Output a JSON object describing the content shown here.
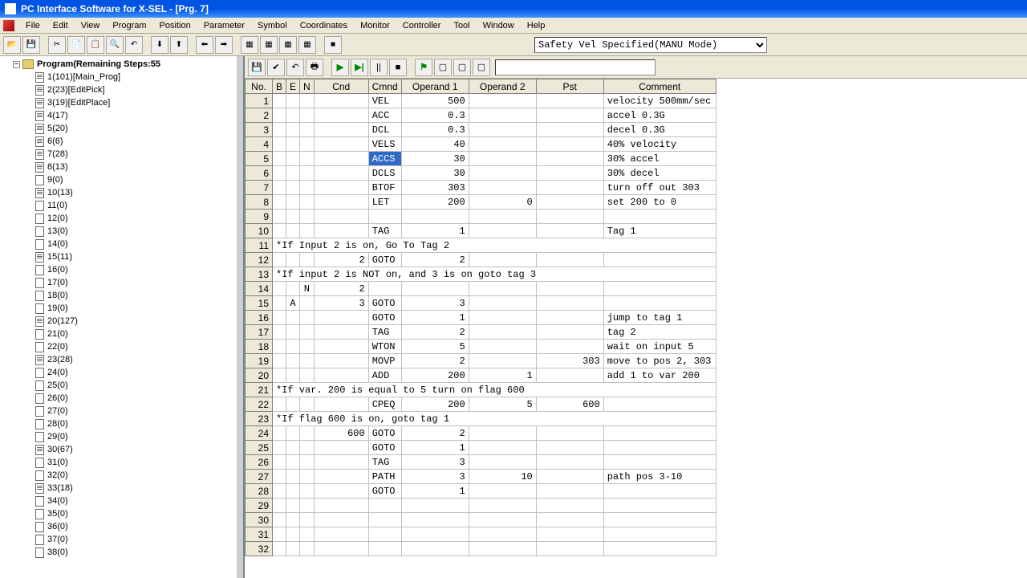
{
  "title": "PC Interface Software for X-SEL - [Prg. 7]",
  "menu": [
    "File",
    "Edit",
    "View",
    "Program",
    "Position",
    "Parameter",
    "Symbol",
    "Coordinates",
    "Monitor",
    "Controller",
    "Tool",
    "Window",
    "Help"
  ],
  "mode_options": [
    "Safety Vel Specified(MANU Mode)"
  ],
  "mode_selected": "Safety Vel Specified(MANU Mode)",
  "tree": {
    "root": "Program(Remaining Steps:55",
    "items": [
      {
        "label": "1(101)[Main_Prog]",
        "filled": true
      },
      {
        "label": "2(23)[EditPick]",
        "filled": true
      },
      {
        "label": "3(19)[EditPlace]",
        "filled": true
      },
      {
        "label": "4(17)",
        "filled": true
      },
      {
        "label": "5(20)",
        "filled": true
      },
      {
        "label": "6(6)",
        "filled": true
      },
      {
        "label": "7(28)",
        "filled": true
      },
      {
        "label": "8(13)",
        "filled": true
      },
      {
        "label": "9(0)",
        "filled": false
      },
      {
        "label": "10(13)",
        "filled": true
      },
      {
        "label": "11(0)",
        "filled": false
      },
      {
        "label": "12(0)",
        "filled": false
      },
      {
        "label": "13(0)",
        "filled": false
      },
      {
        "label": "14(0)",
        "filled": false
      },
      {
        "label": "15(11)",
        "filled": true
      },
      {
        "label": "16(0)",
        "filled": false
      },
      {
        "label": "17(0)",
        "filled": false
      },
      {
        "label": "18(0)",
        "filled": false
      },
      {
        "label": "19(0)",
        "filled": false
      },
      {
        "label": "20(127)",
        "filled": true
      },
      {
        "label": "21(0)",
        "filled": false
      },
      {
        "label": "22(0)",
        "filled": false
      },
      {
        "label": "23(28)",
        "filled": true
      },
      {
        "label": "24(0)",
        "filled": false
      },
      {
        "label": "25(0)",
        "filled": false
      },
      {
        "label": "26(0)",
        "filled": false
      },
      {
        "label": "27(0)",
        "filled": false
      },
      {
        "label": "28(0)",
        "filled": false
      },
      {
        "label": "29(0)",
        "filled": false
      },
      {
        "label": "30(67)",
        "filled": true
      },
      {
        "label": "31(0)",
        "filled": false
      },
      {
        "label": "32(0)",
        "filled": false
      },
      {
        "label": "33(18)",
        "filled": true
      },
      {
        "label": "34(0)",
        "filled": false
      },
      {
        "label": "35(0)",
        "filled": false
      },
      {
        "label": "36(0)",
        "filled": false
      },
      {
        "label": "37(0)",
        "filled": false
      },
      {
        "label": "38(0)",
        "filled": false
      }
    ]
  },
  "grid": {
    "headers": {
      "no": "No.",
      "b": "B",
      "e": "E",
      "n": "N",
      "cnd": "Cnd",
      "cmnd": "Cmnd",
      "op1": "Operand 1",
      "op2": "Operand 2",
      "pst": "Pst",
      "comment": "Comment"
    },
    "rows": [
      {
        "no": 1,
        "cmnd": "VEL",
        "op1": "500",
        "comment": "velocity 500mm/sec"
      },
      {
        "no": 2,
        "cmnd": "ACC",
        "op1": "0.3",
        "comment": "accel 0.3G"
      },
      {
        "no": 3,
        "cmnd": "DCL",
        "op1": "0.3",
        "comment": "decel 0.3G"
      },
      {
        "no": 4,
        "cmnd": "VELS",
        "op1": "40",
        "comment": "40% velocity"
      },
      {
        "no": 5,
        "cmnd": "ACCS",
        "op1": "30",
        "comment": "30% accel",
        "sel": "cmnd"
      },
      {
        "no": 6,
        "cmnd": "DCLS",
        "op1": "30",
        "comment": "30% decel"
      },
      {
        "no": 7,
        "cmnd": "BTOF",
        "op1": "303",
        "comment": "turn off out 303"
      },
      {
        "no": 8,
        "cmnd": "LET",
        "op1": "200",
        "op2": "0",
        "comment": "set 200 to 0"
      },
      {
        "no": 9
      },
      {
        "no": 10,
        "cmnd": "TAG",
        "op1": "1",
        "comment": "Tag 1"
      },
      {
        "no": 11,
        "fullcomment": "*If Input 2 is on, Go To Tag 2"
      },
      {
        "no": 12,
        "cnd": "2",
        "cmnd": "GOTO",
        "op1": "2"
      },
      {
        "no": 13,
        "fullcomment": "*If input 2 is NOT on, and 3 is on goto tag 3"
      },
      {
        "no": 14,
        "n": "N",
        "cnd": "2"
      },
      {
        "no": 15,
        "e": "A",
        "cnd": "3",
        "cmnd": "GOTO",
        "op1": "3"
      },
      {
        "no": 16,
        "cmnd": "GOTO",
        "op1": "1",
        "comment": "jump to tag 1"
      },
      {
        "no": 17,
        "cmnd": "TAG",
        "op1": "2",
        "comment": "tag 2"
      },
      {
        "no": 18,
        "cmnd": "WTON",
        "op1": "5",
        "comment": "wait on input 5"
      },
      {
        "no": 19,
        "cmnd": "MOVP",
        "op1": "2",
        "pst": "303",
        "comment": "move to pos 2, 303"
      },
      {
        "no": 20,
        "cmnd": "ADD",
        "op1": "200",
        "op2": "1",
        "comment": "add 1 to var 200"
      },
      {
        "no": 21,
        "fullcomment": "*If var. 200 is equal to 5 turn on flag 600"
      },
      {
        "no": 22,
        "cmnd": "CPEQ",
        "op1": "200",
        "op2": "5",
        "pst": "600"
      },
      {
        "no": 23,
        "fullcomment": "*If flag 600 is on, goto tag 1"
      },
      {
        "no": 24,
        "cnd": "600",
        "cmnd": "GOTO",
        "op1": "2"
      },
      {
        "no": 25,
        "cmnd": "GOTO",
        "op1": "1"
      },
      {
        "no": 26,
        "cmnd": "TAG",
        "op1": "3"
      },
      {
        "no": 27,
        "cmnd": "PATH",
        "op1": "3",
        "op2": "10",
        "comment": "path pos 3-10"
      },
      {
        "no": 28,
        "cmnd": "GOTO",
        "op1": "1"
      },
      {
        "no": 29
      },
      {
        "no": 30
      },
      {
        "no": 31
      },
      {
        "no": 32
      }
    ]
  },
  "main_toolbar_icons": [
    "open",
    "save",
    "|",
    "cut",
    "copy",
    "paste",
    "find",
    "undo",
    "|",
    "down",
    "up",
    "|",
    "left",
    "right",
    "|",
    "grid1",
    "grid2",
    "grid3",
    "grid4",
    "|",
    "stop"
  ],
  "editor_toolbar_icons": [
    "save",
    "check",
    "undo",
    "print",
    "|",
    "run",
    "step",
    "pause",
    "stop2",
    "|",
    "flag",
    "box1",
    "box2",
    "box3"
  ]
}
